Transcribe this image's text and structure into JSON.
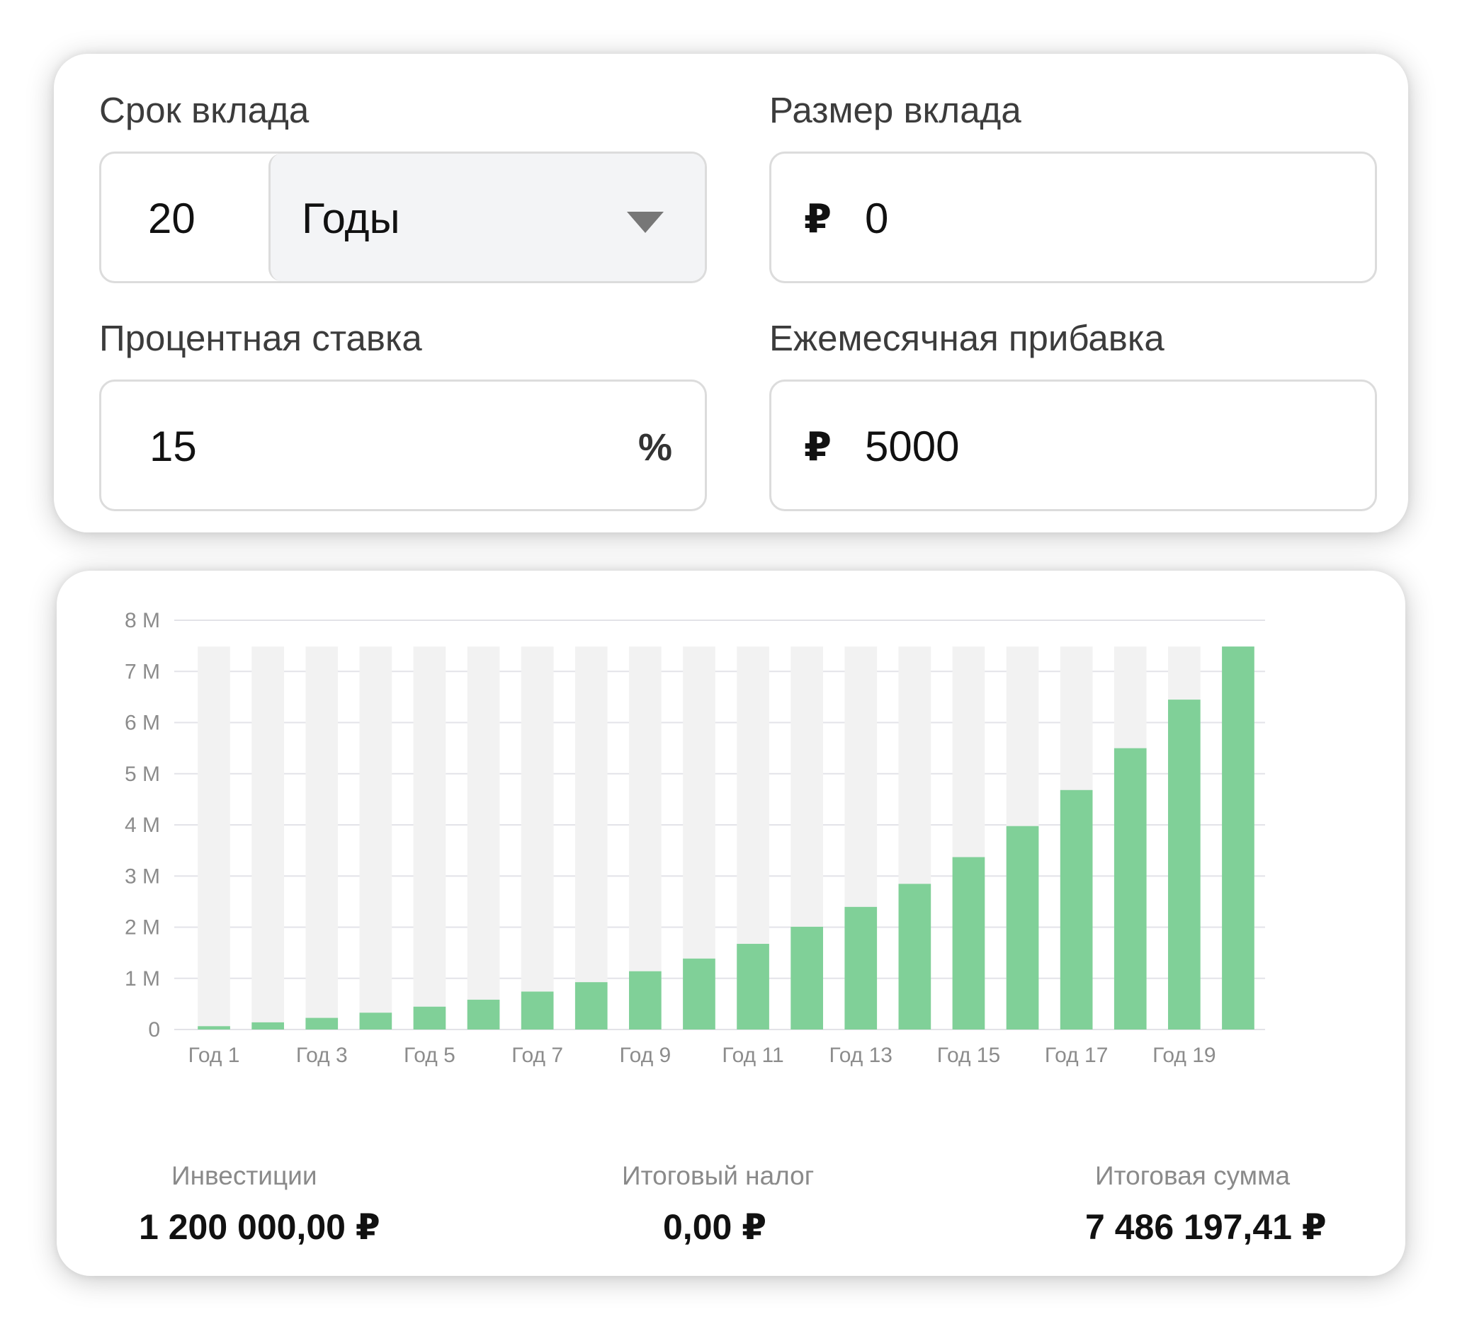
{
  "form": {
    "term": {
      "label": "Срок вклада",
      "value": "20",
      "unit_selected": "Годы"
    },
    "amount": {
      "label": "Размер вклада",
      "currency": "₽",
      "value": "0"
    },
    "rate": {
      "label": "Процентная ставка",
      "value": "15",
      "suffix": "%"
    },
    "monthly": {
      "label": "Ежемесячная прибавка",
      "currency": "₽",
      "value": "5000"
    }
  },
  "icons": {
    "select_caret": "chevron-down-icon",
    "currency": "ruble-icon"
  },
  "colors": {
    "bar": "#80d098",
    "bar_background": "#f2f2f2",
    "grid": "#e3e3e8"
  },
  "chart_data": {
    "type": "bar",
    "categories": [
      "Год 1",
      "Год 2",
      "Год 3",
      "Год 4",
      "Год 5",
      "Год 6",
      "Год 7",
      "Год 8",
      "Год 9",
      "Год 10",
      "Год 11",
      "Год 12",
      "Год 13",
      "Год 14",
      "Год 15",
      "Год 16",
      "Год 17",
      "Год 18",
      "Год 19",
      "Год 20"
    ],
    "visible_tick_labels": [
      "Год 1",
      "Год 3",
      "Год 5",
      "Год 7",
      "Год 9",
      "Год 11",
      "Год 13",
      "Год 15",
      "Год 17",
      "Год 19"
    ],
    "values": [
      64700,
      139800,
      227100,
      328400,
      446000,
      582500,
      741100,
      925000,
      1138600,
      1386500,
      1674400,
      2008500,
      2396500,
      2846800,
      3369600,
      3976500,
      4681000,
      5498900,
      6448400,
      7486197.41
    ],
    "background_max": 7486197.41,
    "yticks": [
      0,
      1000000,
      2000000,
      3000000,
      4000000,
      5000000,
      6000000,
      7000000,
      8000000
    ],
    "ytick_labels": [
      "0",
      "1 M",
      "2 M",
      "3 M",
      "4 M",
      "5 M",
      "6 M",
      "7 M",
      "8 M"
    ],
    "ylim": [
      0,
      8000000
    ],
    "grid": true,
    "legend": "none"
  },
  "summary": {
    "investments": {
      "label": "Инвестиции",
      "value": "1 200 000,00 ₽"
    },
    "tax": {
      "label": "Итоговый налог",
      "value": "0,00 ₽"
    },
    "total": {
      "label": "Итоговая сумма",
      "value": "7 486 197,41 ₽"
    }
  }
}
